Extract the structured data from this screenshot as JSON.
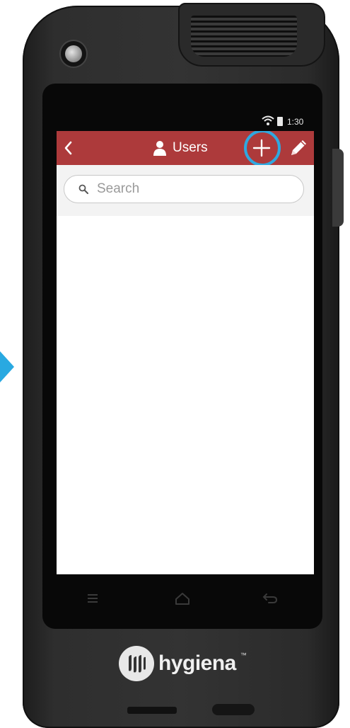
{
  "status_bar": {
    "time": "1:30"
  },
  "app_bar": {
    "title": "Users",
    "icons": {
      "back": "back-chevron-icon",
      "title": "user-icon",
      "add": "plus-icon",
      "edit": "pencil-icon"
    },
    "highlight_color": "#2fa8e0",
    "bar_color": "#ad3a3b"
  },
  "search": {
    "placeholder": "Search",
    "value": ""
  },
  "nav_bar": {
    "icons": [
      "menu-icon",
      "home-icon",
      "back-arrow-icon"
    ]
  },
  "device": {
    "brand": "hygiena",
    "trademark": "™"
  }
}
